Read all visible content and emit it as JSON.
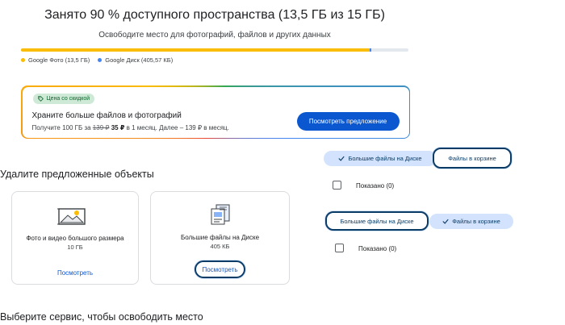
{
  "header": {
    "title": "Занято 90 % доступного пространства (13,5 ГБ из 15 ГБ)",
    "subtitle": "Освободите место для фотографий, файлов и других данных"
  },
  "storage": {
    "segments": [
      {
        "name": "Google Фото",
        "fraction": 0.9,
        "color": "#fbbc04"
      },
      {
        "name": "Google Диск",
        "fraction": 0.005,
        "color": "#4285f4"
      }
    ],
    "legend": [
      {
        "label": "Google Фото (13,5 ГБ)",
        "color": "#fbbc04"
      },
      {
        "label": "Google Диск (405,57 КБ)",
        "color": "#4285f4"
      }
    ]
  },
  "promo": {
    "badge": "Цена со скидкой",
    "title": "Храните больше файлов и фотографий",
    "desc_prefix": "Получите 100 ГБ за ",
    "old_price": "139 ₽",
    "new_price": "35 ₽",
    "desc_suffix": " в 1 месяц. Далее – 139 ₽ в месяц.",
    "button": "Посмотреть предложение"
  },
  "suggestions": {
    "title": "Удалите предложенные объекты",
    "cards": [
      {
        "label": "Фото и видео большого размера",
        "size": "10 ГБ",
        "link": "Посмотреть"
      },
      {
        "label": "Большие файлы на Диске",
        "size": "405 КБ",
        "link": "Посмотреть"
      }
    ]
  },
  "services": {
    "title": "Выберите сервис, чтобы освободить место"
  },
  "toggle_group_1": {
    "option_1": "Большие файлы на Диске",
    "option_2": "Файлы в корзине",
    "selected": "option_1",
    "shown": "Показано (0)"
  },
  "toggle_group_2": {
    "option_1": "Большие файлы на Диске",
    "option_2": "Файлы в корзине",
    "selected": "option_2",
    "shown": "Показано (0)"
  },
  "icons": {
    "check": "check-icon",
    "tag": "tag-icon",
    "photo": "photo-icon",
    "files": "files-icon"
  }
}
